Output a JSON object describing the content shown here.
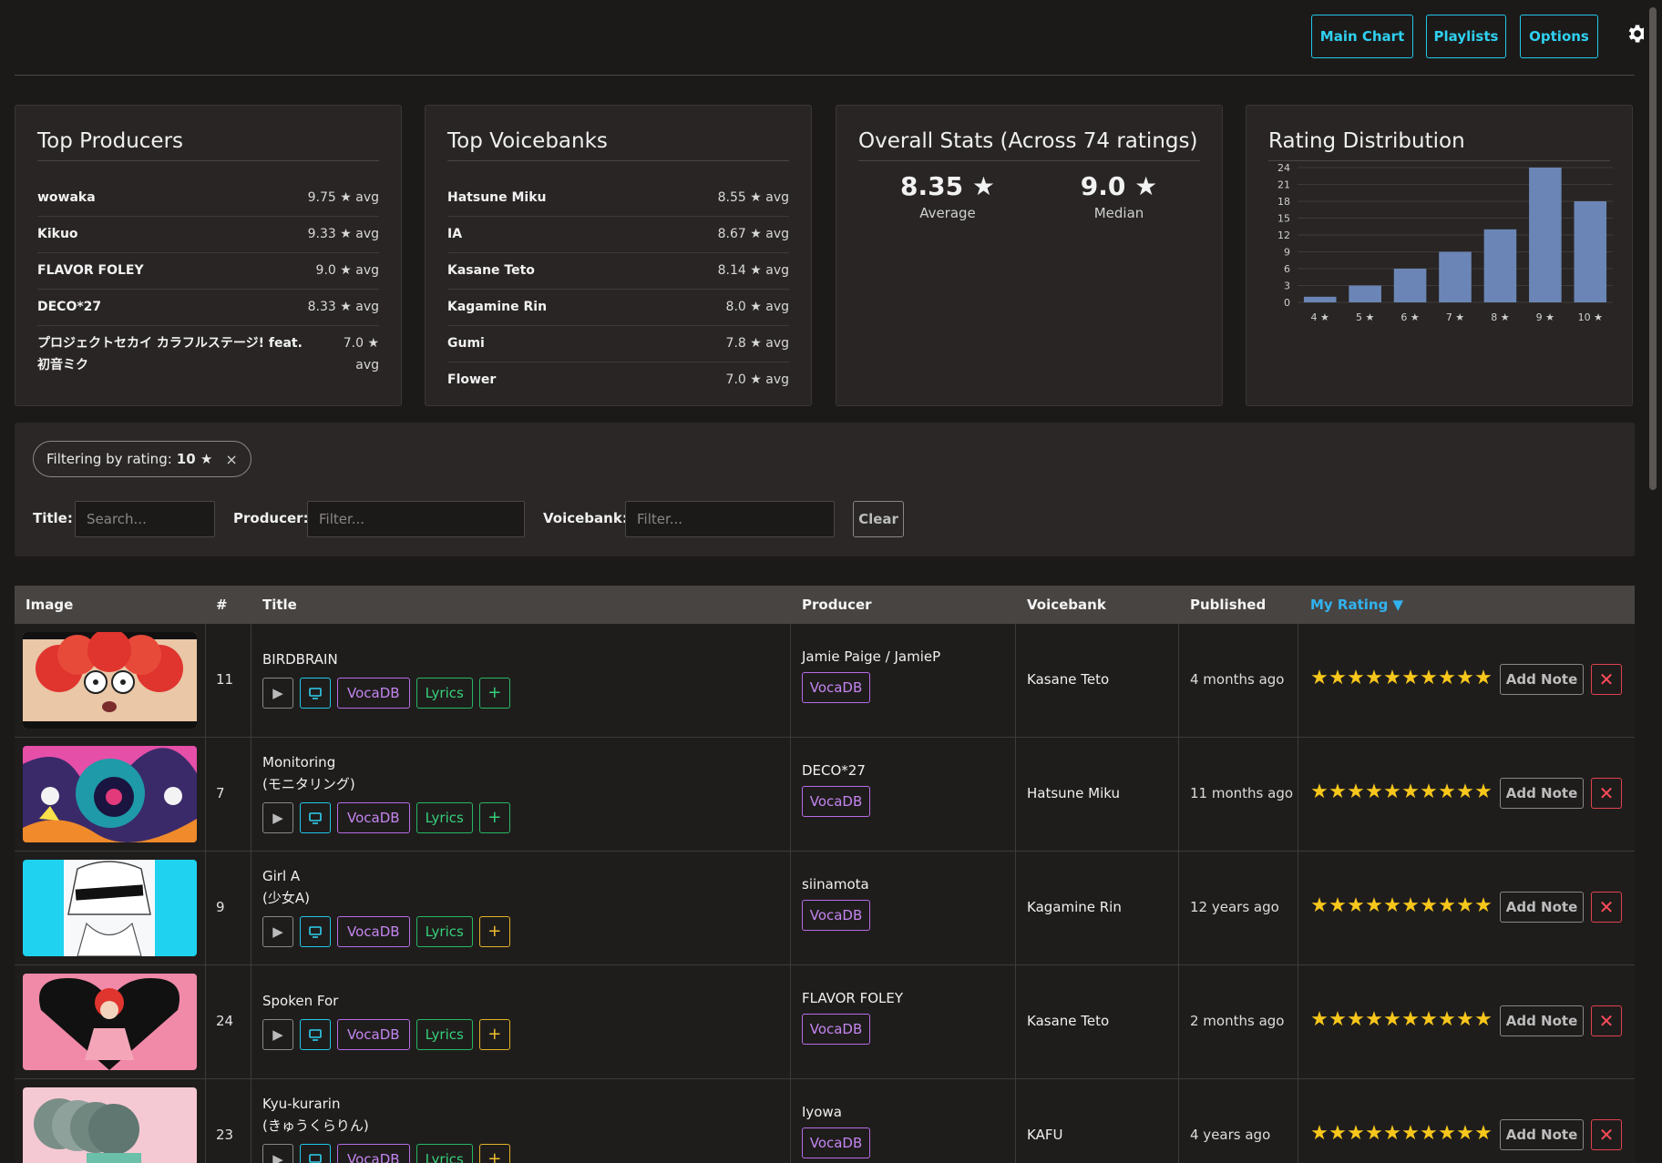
{
  "nav": {
    "main_chart": "Main Chart",
    "playlists": "Playlists",
    "options": "Options"
  },
  "producers": {
    "title": "Top Producers",
    "items": [
      {
        "name": "wowaka",
        "value": "9.75 ★ avg"
      },
      {
        "name": "Kikuo",
        "value": "9.33 ★ avg"
      },
      {
        "name": "FLAVOR FOLEY",
        "value": "9.0 ★ avg"
      },
      {
        "name": "DECO*27",
        "value": "8.33 ★ avg"
      },
      {
        "name": "プロジェクトセカイ カラフルステージ! feat. 初音ミク",
        "value": "7.0 ★ avg"
      }
    ]
  },
  "voicebanks": {
    "title": "Top Voicebanks",
    "items": [
      {
        "name": "Hatsune Miku",
        "value": "8.55 ★ avg"
      },
      {
        "name": "IA",
        "value": "8.67 ★ avg"
      },
      {
        "name": "Kasane Teto",
        "value": "8.14 ★ avg"
      },
      {
        "name": "Kagamine Rin",
        "value": "8.0 ★ avg"
      },
      {
        "name": "Gumi",
        "value": "7.8 ★ avg"
      },
      {
        "name": "Flower",
        "value": "7.0 ★ avg"
      }
    ]
  },
  "overall": {
    "title": "Overall Stats (Across 74 ratings)",
    "average": "8.35 ★",
    "average_label": "Average",
    "median": "9.0 ★",
    "median_label": "Median"
  },
  "chart_data": {
    "type": "bar",
    "title": "Rating Distribution",
    "categories": [
      "4 ★",
      "5 ★",
      "6 ★",
      "7 ★",
      "8 ★",
      "9 ★",
      "10 ★"
    ],
    "values": [
      1,
      3,
      6,
      9,
      13,
      24,
      18
    ],
    "yticks": [
      "0",
      "3",
      "6",
      "9",
      "12",
      "15",
      "18",
      "21",
      "24"
    ],
    "ylim": [
      0,
      24
    ],
    "grid": true,
    "bar_color": "#6b86b6"
  },
  "filters": {
    "chip_label": "Filtering by rating:",
    "chip_value": "10 ★",
    "chip_close": "×",
    "title_label": "Title:",
    "title_placeholder": "Search...",
    "producer_label": "Producer:",
    "producer_placeholder": "Filter...",
    "voicebank_label": "Voicebank:",
    "voicebank_placeholder": "Filter...",
    "clear": "Clear"
  },
  "table": {
    "headers": {
      "image": "Image",
      "num": "#",
      "title": "Title",
      "producer": "Producer",
      "voicebank": "Voicebank",
      "published": "Published",
      "rating": "My Rating ▼"
    },
    "buttons": {
      "vocadb": "VocaDB",
      "lyrics": "Lyrics",
      "plus": "+",
      "add_note": "Add Note",
      "delete": "✕"
    },
    "rows": [
      {
        "rank": "11",
        "title": "BIRDBRAIN",
        "subtitle": "",
        "producer": "Jamie Paige / JamieP",
        "voicebank": "Kasane Teto",
        "published": "4 months ago",
        "stars": 10,
        "plus_color": "green"
      },
      {
        "rank": "7",
        "title": "Monitoring",
        "subtitle": "(モニタリング)",
        "producer": "DECO*27",
        "voicebank": "Hatsune Miku",
        "published": "11 months ago",
        "stars": 10,
        "plus_color": "green"
      },
      {
        "rank": "9",
        "title": "Girl A",
        "subtitle": "(少女A)",
        "producer": "siinamota",
        "voicebank": "Kagamine Rin",
        "published": "12 years ago",
        "stars": 10,
        "plus_color": "yellow"
      },
      {
        "rank": "24",
        "title": "Spoken For",
        "subtitle": "",
        "producer": "FLAVOR FOLEY",
        "voicebank": "Kasane Teto",
        "published": "2 months ago",
        "stars": 10,
        "plus_color": "yellow"
      },
      {
        "rank": "23",
        "title": "Kyu-kurarin",
        "subtitle": "(きゅうくらりん)",
        "producer": "Iyowa",
        "voicebank": "KAFU",
        "published": "4 years ago",
        "stars": 10,
        "plus_color": "yellow"
      }
    ]
  },
  "colors": {
    "accent": "#2fd0f0",
    "vocadb": "#c485ef",
    "lyrics": "#35d07a",
    "star": "#f8c71c",
    "delete": "#ff4c5a"
  }
}
